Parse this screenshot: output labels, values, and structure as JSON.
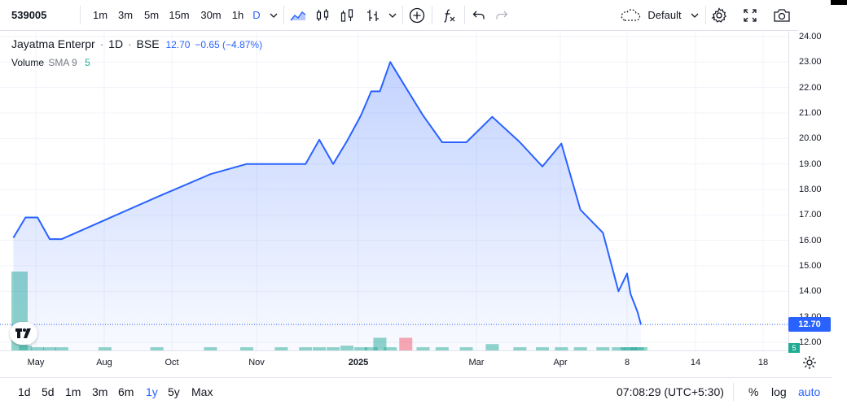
{
  "toolbar": {
    "symbol": "539005",
    "intervals": [
      "1m",
      "3m",
      "5m",
      "15m",
      "30m",
      "1h",
      "D"
    ],
    "active_interval": "D",
    "layout_name": "Default",
    "icons": [
      "chevron-down-icon",
      "area-chart-icon",
      "candles-icon",
      "bars-icon",
      "hlc-bars-icon",
      "add-indicator-icon",
      "fx-icon",
      "undo-icon",
      "redo-icon",
      "cloud-icon",
      "settings-icon",
      "fullscreen-icon",
      "camera-icon"
    ]
  },
  "legend": {
    "name": "Jayatma Enterpr",
    "interval": "1D",
    "exchange": "BSE",
    "last": "12.70",
    "change": "−0.65 (−4.87%)",
    "volume_label": "Volume",
    "sma_label": "SMA 9",
    "volume_value": "5"
  },
  "price_scale": {
    "ticks": [
      "24.00",
      "23.00",
      "22.00",
      "21.00",
      "20.00",
      "19.00",
      "18.00",
      "17.00",
      "16.00",
      "15.00",
      "14.00",
      "12.00"
    ],
    "partial_tick": "13.00",
    "last_price_badge": "12.70",
    "volume_badge": "5"
  },
  "time_axis": {
    "ticks": [
      {
        "label": "May",
        "bold": false
      },
      {
        "label": "Aug",
        "bold": false
      },
      {
        "label": "Oct",
        "bold": false
      },
      {
        "label": "Nov",
        "bold": false
      },
      {
        "label": "2025",
        "bold": true
      },
      {
        "label": "Mar",
        "bold": false
      },
      {
        "label": "Apr",
        "bold": false
      },
      {
        "label": "8",
        "bold": false
      },
      {
        "label": "14",
        "bold": false
      },
      {
        "label": "18",
        "bold": false
      }
    ]
  },
  "bottom_bar": {
    "ranges": [
      "1d",
      "5d",
      "1m",
      "3m",
      "6m",
      "1y",
      "5y",
      "Max"
    ],
    "active_range": "1y",
    "clock": "07:08:29 (UTC+5:30)",
    "percent": "%",
    "log": "log",
    "auto": "auto"
  },
  "colors": {
    "line": "#2962ff",
    "volume_up": "#22ab94",
    "volume_down": "#f7525f",
    "accent": "#2962ff"
  },
  "chart_data": {
    "type": "area",
    "title": "Jayatma Enterpr · 1D · BSE",
    "xlabel": "",
    "ylabel": "",
    "ylim": [
      11.8,
      24.1
    ],
    "x": [
      "2024-04-18",
      "2024-04-25",
      "2024-05-02",
      "2024-05-09",
      "2024-05-16",
      "2024-06-10",
      "2024-07-10",
      "2024-08-10",
      "2024-08-31",
      "2024-09-20",
      "2024-10-04",
      "2024-10-12",
      "2024-10-20",
      "2024-10-28",
      "2024-11-05",
      "2024-11-11",
      "2024-11-16",
      "2024-11-22",
      "2024-12-01",
      "2024-12-11",
      "2024-12-22",
      "2025-01-05",
      "2025-01-20",
      "2025-02-05",
      "2025-02-18",
      "2025-03-01",
      "2025-03-12",
      "2025-03-25",
      "2025-04-03",
      "2025-04-08",
      "2025-04-10",
      "2025-04-14",
      "2025-04-16"
    ],
    "series": [
      {
        "values": [
          16.1,
          16.9,
          16.9,
          16.05,
          16.05,
          16.8,
          17.7,
          18.6,
          19.0,
          19.0,
          19.0,
          19.95,
          19.0,
          19.9,
          20.9,
          21.85,
          21.85,
          23.0,
          22.0,
          20.9,
          19.85,
          19.85,
          20.85,
          19.85,
          18.9,
          19.8,
          17.2,
          16.3,
          14.0,
          14.7,
          13.9,
          13.2,
          12.7
        ]
      }
    ],
    "volume": [
      5,
      0.3,
      0.2,
      0.2,
      0.2,
      0.2,
      0.2,
      0.2,
      0.2,
      0.2,
      0.2,
      0.2,
      0.2,
      0.3,
      0.2,
      0.2,
      0.8,
      0.2,
      0.8,
      0.2,
      0.2,
      0.2,
      0.4,
      0.2,
      0.2,
      0.2,
      0.2,
      0.2,
      0.2,
      0.2,
      0.2,
      0.2,
      0.2
    ],
    "volume_sma_9": 5,
    "last_price": 12.7,
    "grid": true
  }
}
